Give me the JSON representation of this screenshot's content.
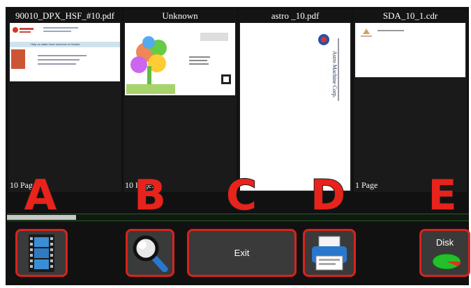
{
  "files": [
    {
      "name": "90010_DPX_HSF_#10.pdf",
      "pages": "10 Pages",
      "thumb_text": "Help us make more survivors in Ontario."
    },
    {
      "name": "Unknown",
      "pages": "10 Pages"
    },
    {
      "name": "astro _10.pdf",
      "pages": "1 Page",
      "thumb_text": "Astro Machine Corp."
    },
    {
      "name": "SDA_10_1.cdr",
      "pages": "1 Page"
    }
  ],
  "progress": 0.15,
  "buttons": {
    "film_icon": "film-strip-icon",
    "search_icon": "magnifier-icon",
    "exit_label": "Exit",
    "print_icon": "printer-icon",
    "disk_label": "Disk",
    "disk_icon": "disk-icon"
  },
  "callouts": [
    "A",
    "B",
    "C",
    "D",
    "E"
  ],
  "colors": {
    "accent": "#d8231c",
    "callout": "#e8231b",
    "disk": "#22c02a"
  }
}
